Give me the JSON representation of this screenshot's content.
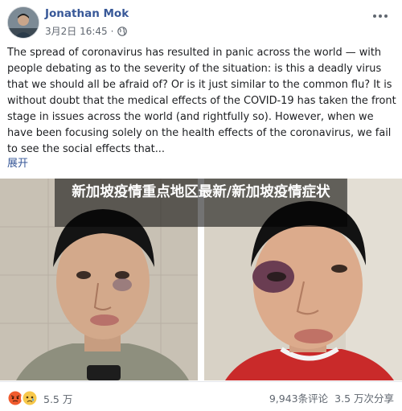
{
  "post": {
    "author": "Jonathan Mok",
    "date": "3月2日 16:45",
    "dot": "·",
    "body_text": "The spread of coronavirus has resulted in panic across the world — with people debating as to the severity of the situation: is this a deadly virus that we should all be afraid of? Or is it just similar to the common flu? It is without doubt that the medical effects of the COVID-19 has taken the front stage in issues across the world (and rightfully so). However, when we have been focusing solely on the health effects of the coronavirus, we fail to see the social effects that...",
    "see_more": "展开",
    "icons": {
      "globe": "globe-icon",
      "more": "more-options-icon",
      "angry": "angry-reaction-icon",
      "sad": "sad-reaction-icon"
    }
  },
  "overlay": {
    "headline": "新加坡疫情重点地区最新/新加坡疫情症状"
  },
  "footer": {
    "reaction_count": "5.5 万",
    "comments": "9,943条评论",
    "shares": "3.5 万次分享"
  },
  "colors": {
    "link": "#385898",
    "secondary_text": "#606770",
    "angry": "#f05b2e",
    "sad": "#f7c84b"
  }
}
